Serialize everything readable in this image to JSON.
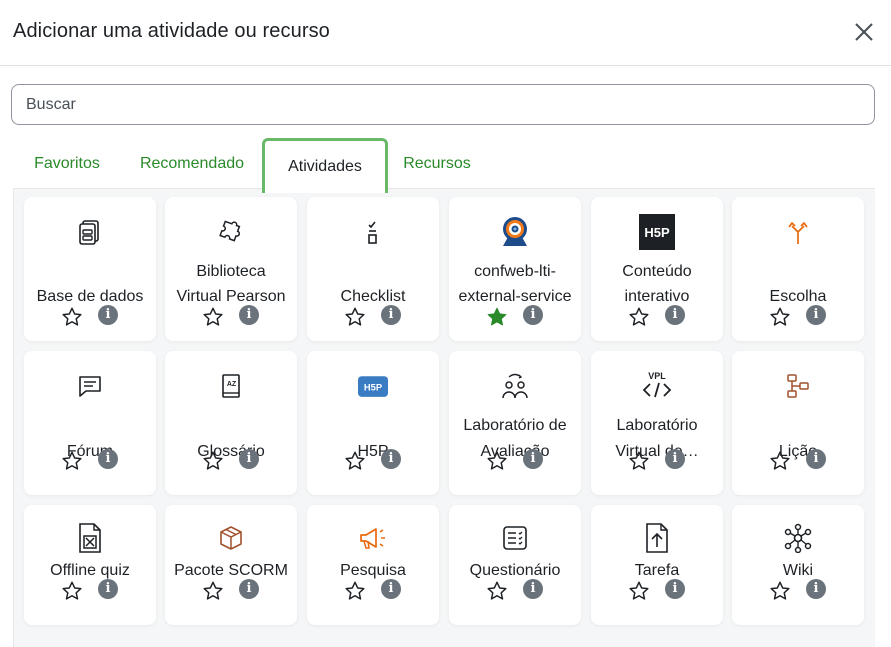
{
  "dialog": {
    "title": "Adicionar uma atividade ou recurso",
    "close_icon": "close-icon"
  },
  "search": {
    "placeholder": "Buscar",
    "value": ""
  },
  "tabs": [
    {
      "label": "Favoritos",
      "active": false
    },
    {
      "label": "Recomendado",
      "active": false
    },
    {
      "label": "Atividades",
      "active": true
    },
    {
      "label": "Recursos",
      "active": false
    }
  ],
  "colors": {
    "accent_green": "#2a8a2a",
    "active_tab_border": "#6ab86a",
    "orange_icon": "#e8690c",
    "brown_icon": "#a0522d",
    "h5p_blue": "#3a7cc4",
    "info_grey": "#6a737b"
  },
  "activities": [
    {
      "line1": "",
      "line2": "Base de dados",
      "icon": "database-icon",
      "favorite": false
    },
    {
      "line1": "Biblioteca",
      "line2": "Virtual Pearson",
      "icon": "puzzle-icon",
      "favorite": false
    },
    {
      "line1": "",
      "line2": "Checklist",
      "icon": "checklist-icon",
      "favorite": false
    },
    {
      "line1": "confweb-lti-",
      "line2": "external-service",
      "icon": "webcam-icon",
      "favorite": true
    },
    {
      "line1": "Conteúdo",
      "line2": "interativo",
      "icon": "h5p-dark-icon",
      "favorite": false
    },
    {
      "line1": "",
      "line2": "Escolha",
      "icon": "choice-icon",
      "favorite": false
    },
    {
      "line1": "",
      "line2": "Fórum",
      "icon": "forum-icon",
      "favorite": false
    },
    {
      "line1": "",
      "line2": "Glossário",
      "icon": "glossary-icon",
      "favorite": false
    },
    {
      "line1": "",
      "line2": "H5P",
      "icon": "h5p-icon",
      "favorite": false
    },
    {
      "line1": "Laboratório de",
      "line2": "Avaliação",
      "icon": "workshop-icon",
      "favorite": false
    },
    {
      "line1": "Laboratório",
      "line2": "Virtual de…",
      "icon": "vpl-icon",
      "favorite": false
    },
    {
      "line1": "",
      "line2": "Lição",
      "icon": "lesson-icon",
      "favorite": false
    },
    {
      "line1": "",
      "line2": "Offline quiz",
      "icon": "offline-quiz-icon",
      "favorite": false
    },
    {
      "line1": "",
      "line2": "Pacote SCORM",
      "icon": "scorm-icon",
      "favorite": false
    },
    {
      "line1": "",
      "line2": "Pesquisa",
      "icon": "megaphone-icon",
      "favorite": false
    },
    {
      "line1": "",
      "line2": "Questionário",
      "icon": "quiz-icon",
      "favorite": false
    },
    {
      "line1": "",
      "line2": "Tarefa",
      "icon": "assignment-icon",
      "favorite": false
    },
    {
      "line1": "",
      "line2": "Wiki",
      "icon": "wiki-icon",
      "favorite": false
    }
  ],
  "badges": {
    "h5p_text": "H5P",
    "vpl_text": "VPL",
    "info_glyph": "i",
    "glossary_text": "AZ"
  }
}
